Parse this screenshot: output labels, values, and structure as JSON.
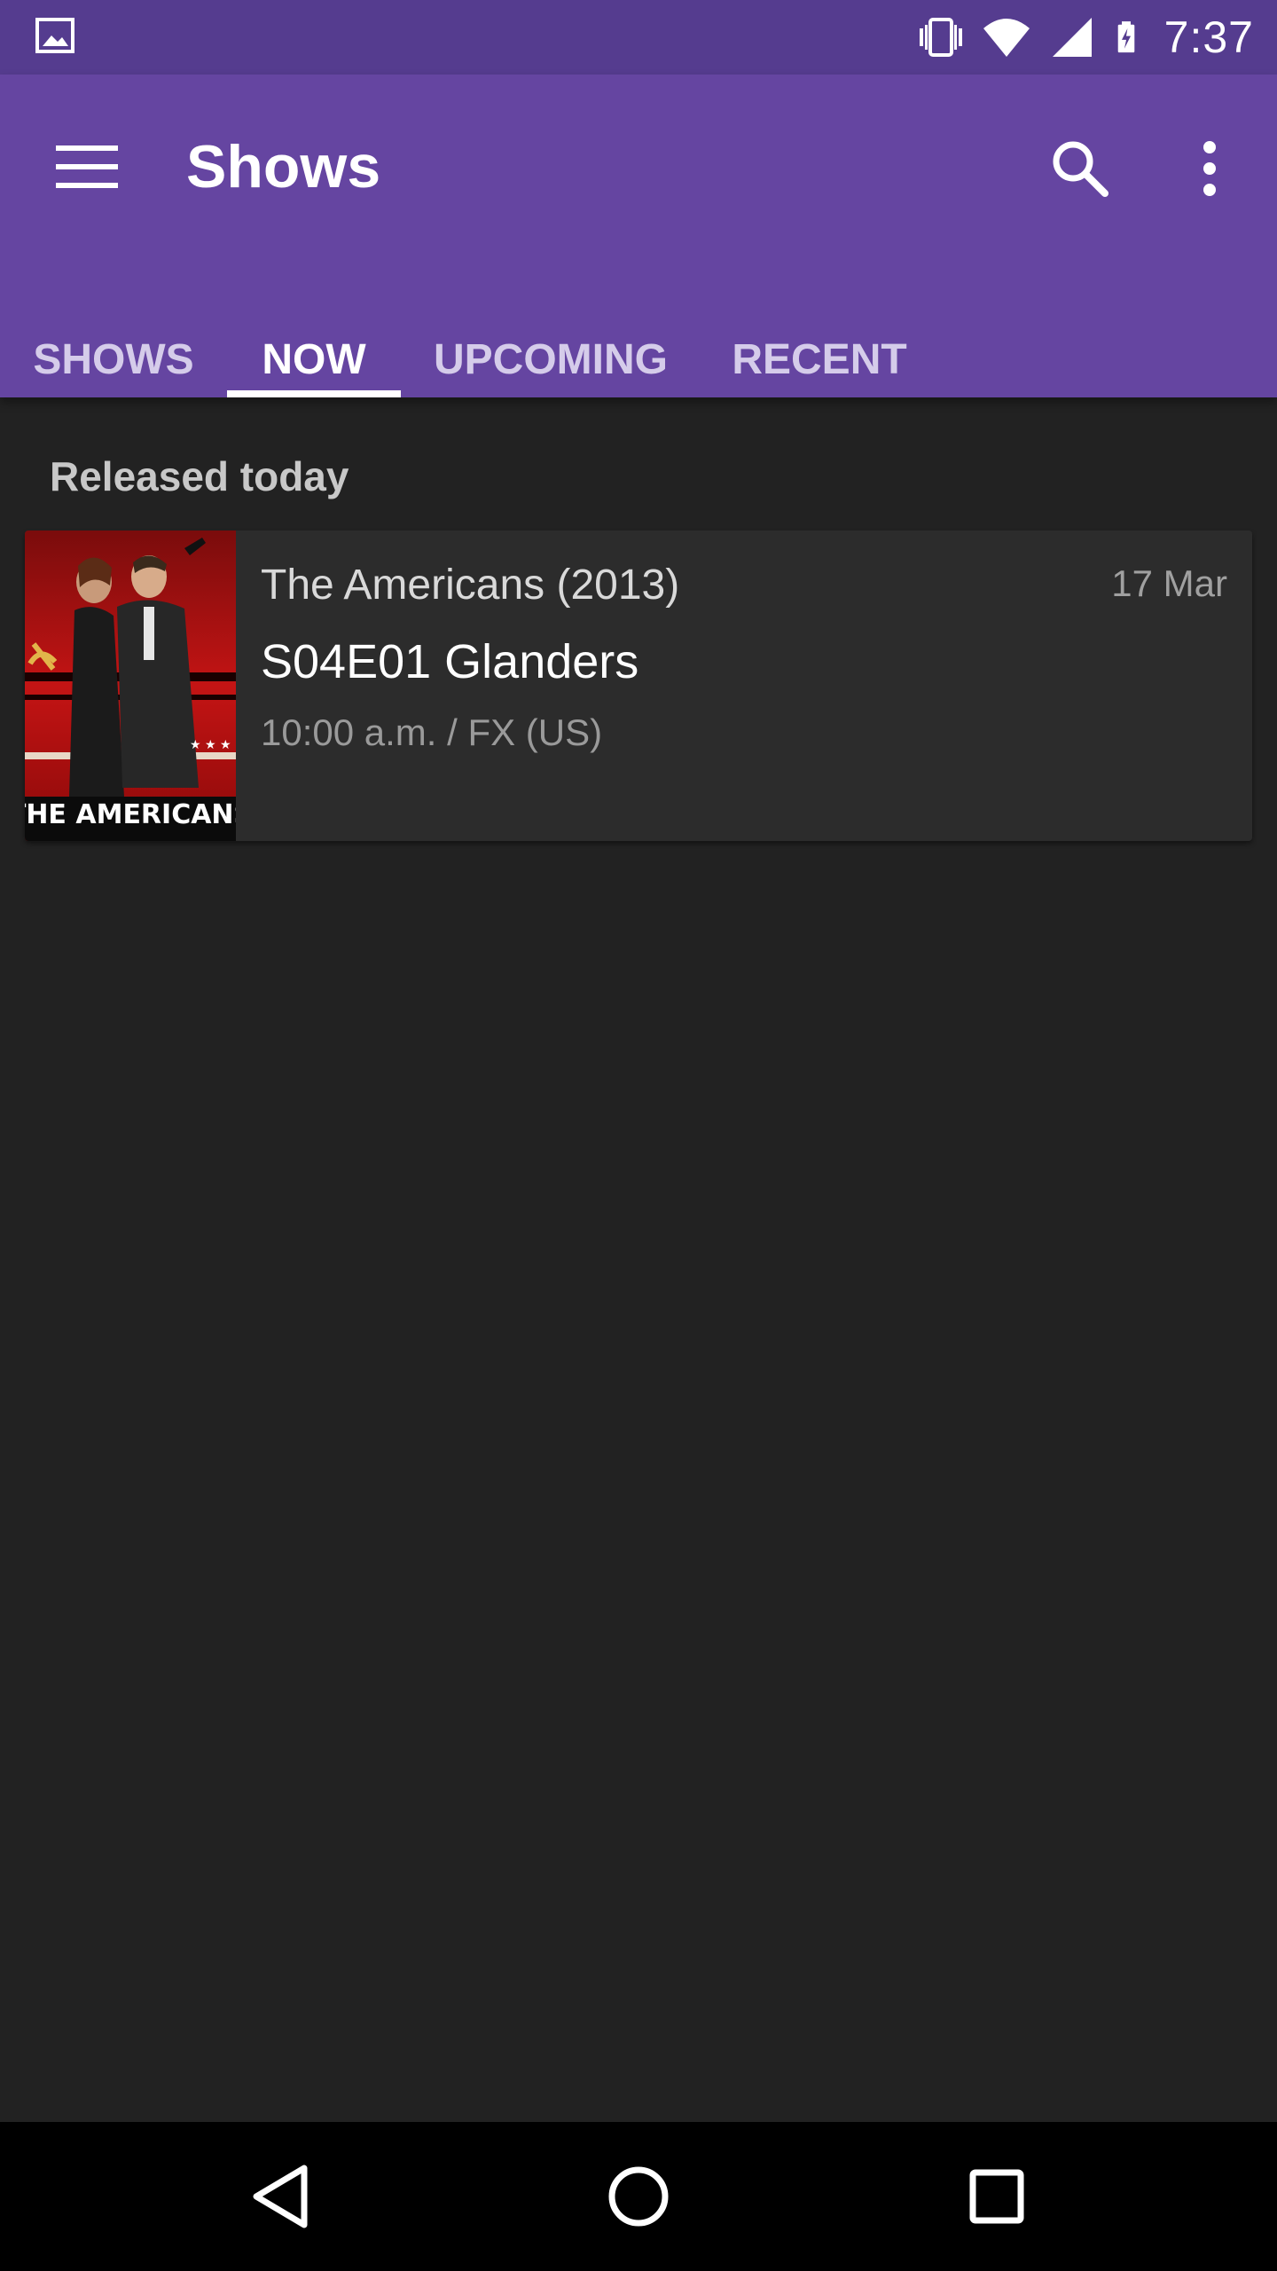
{
  "status_bar": {
    "time": "7:37",
    "icons": [
      "image-notification-icon",
      "vibrate-icon",
      "wifi-icon",
      "cell-signal-icon",
      "battery-charging-icon"
    ]
  },
  "app_bar": {
    "title": "Shows",
    "menu_icon": "menu-icon",
    "search_icon": "search-icon",
    "more_icon": "more-vert-icon",
    "background_color": "#6545a1",
    "status_color": "#553c8f"
  },
  "tabs": [
    {
      "label": "SHOWS",
      "active": false
    },
    {
      "label": "NOW",
      "active": true
    },
    {
      "label": "UPCOMING",
      "active": false
    },
    {
      "label": "RECENT",
      "active": false
    }
  ],
  "content": {
    "section_header": "Released today",
    "items": [
      {
        "show_title": "The Americans (2013)",
        "episode": "S04E01 Glanders",
        "airtime": "10:00 a.m. / FX (US)",
        "date": "17 Mar",
        "poster_text": "THE AMERICANS"
      }
    ]
  },
  "nav_bar": {
    "icons": [
      "back-icon",
      "home-icon",
      "recents-icon"
    ]
  }
}
